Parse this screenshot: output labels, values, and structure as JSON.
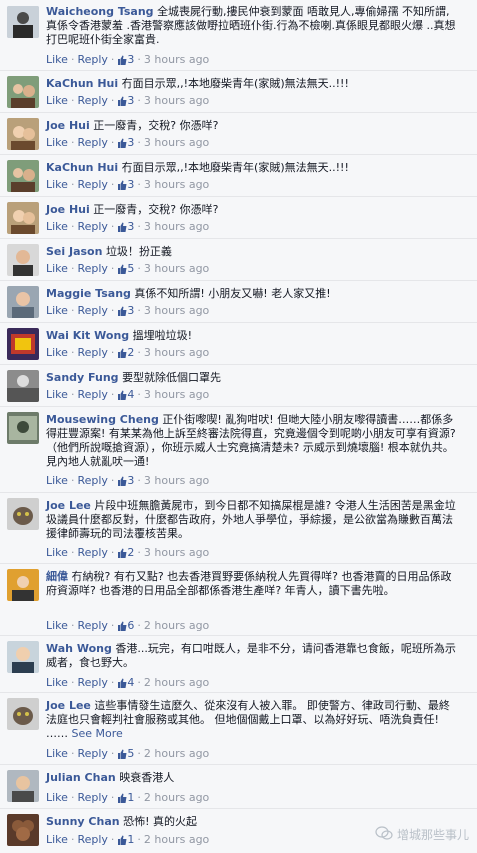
{
  "comments": [
    {
      "name": "Waicheong Tsang",
      "text": "全城喪屍行動,摟民仲衰到蒙面 唔敢見人,專偷婦孺 不知所謂,真係令香港蒙羞 .香港警察應該做嘢拉晒班仆街.行為不檢喇.真係眼見都眼火爆 ..真想打巴呢班仆街全家富貴.",
      "like": "Like",
      "reply": "Reply",
      "likes": "3",
      "time": "3 hours ago",
      "see_more": ""
    },
    {
      "name": "KaChun Hui",
      "text": "冇面目示眾,,!本地廢柴青年(家賊)無法無天..!!!",
      "like": "Like",
      "reply": "Reply",
      "likes": "3",
      "time": "3 hours ago",
      "see_more": ""
    },
    {
      "name": "Joe Hui",
      "text": "正一廢青，交稅? 你憑咩?",
      "like": "Like",
      "reply": "Reply",
      "likes": "3",
      "time": "3 hours ago",
      "see_more": ""
    },
    {
      "name": "KaChun Hui",
      "text": "冇面目示眾,,!本地廢柴青年(家賊)無法無天..!!!",
      "like": "Like",
      "reply": "Reply",
      "likes": "3",
      "time": "3 hours ago",
      "see_more": ""
    },
    {
      "name": "Joe Hui",
      "text": "正一廢青，交稅? 你憑咩?",
      "like": "Like",
      "reply": "Reply",
      "likes": "3",
      "time": "3 hours ago",
      "see_more": ""
    },
    {
      "name": "Sei Jason",
      "text": "垃圾！扮正義",
      "like": "Like",
      "reply": "Reply",
      "likes": "5",
      "time": "3 hours ago",
      "see_more": ""
    },
    {
      "name": "Maggie Tsang",
      "text": "真係不知所謂! 小朋友又嚇! 老人家又推!",
      "like": "Like",
      "reply": "Reply",
      "likes": "3",
      "time": "3 hours ago",
      "see_more": ""
    },
    {
      "name": "Wai Kit Wong",
      "text": "搵埋啦垃圾!",
      "like": "Like",
      "reply": "Reply",
      "likes": "2",
      "time": "3 hours ago",
      "see_more": ""
    },
    {
      "name": "Sandy Fung",
      "text": "要型就除低個口罩先",
      "like": "Like",
      "reply": "Reply",
      "likes": "4",
      "time": "3 hours ago",
      "see_more": ""
    },
    {
      "name": "Mousewing Cheng",
      "text": "正仆街嚟喫! 亂狗咁吠! 但哋大陸小朋友嚟得讀書……都係多得莊豐源案! 有某某為他上訴至終審法院得直，究竟邊個令到呢啲小朋友可享有資源? （他們所說嘅搶資源），你班示威人士究竟搞清楚未? 示威示到燒壞腦! 根本就仇共。見內地人就亂吠一通!",
      "like": "Like",
      "reply": "Reply",
      "likes": "3",
      "time": "3 hours ago",
      "see_more": ""
    },
    {
      "name": "Joe Lee",
      "text": "片段中班無膽黃屍市，到今日都不知搞屎棍是誰? 令港人生活困苦是黑金垃圾議員什麼都反對，什麼都告政府，外地人爭學位，爭綜援，是公欲當為賺數百萬法援律師壽玩的司法覆核苦果。",
      "like": "Like",
      "reply": "Reply",
      "likes": "2",
      "time": "3 hours ago",
      "see_more": ""
    },
    {
      "name": "細偉",
      "text": "冇納稅? 有冇又點? 也去香港買野要係納稅人先買得咩? 也香港賣的日用品係政府資源咩? 也香港的日用品全部都係香港生產咩? 年青人，讀下書先啦。",
      "like": "Like",
      "reply": "Reply",
      "likes": "6",
      "time": "2 hours ago",
      "see_more": ""
    },
    {
      "name": "Wah Wong",
      "text": "香港...玩完，有口咁既人，是非不分，请问香港靠乜食飯，呢班所為示威者，食乜野大。",
      "like": "Like",
      "reply": "Reply",
      "likes": "4",
      "time": "2 hours ago",
      "see_more": ""
    },
    {
      "name": "Joe Lee",
      "text": "這些事情發生這麼久、從來沒有人被入罪。 即使警方、律政司行動、最終法庭也只會輕判社會服務或其他。 但地個個戴上口罩、以為好好玩、唔洗負責任! ……",
      "like": "Like",
      "reply": "Reply",
      "likes": "5",
      "time": "2 hours ago",
      "see_more": "See More"
    },
    {
      "name": "Julian Chan",
      "text": "映衰香港人",
      "like": "Like",
      "reply": "Reply",
      "likes": "1",
      "time": "2 hours ago",
      "see_more": ""
    },
    {
      "name": "Sunny Chan",
      "text": "恐怖! 真的火起",
      "like": "Like",
      "reply": "Reply",
      "likes": "1",
      "time": "2 hours ago",
      "see_more": ""
    }
  ],
  "watermark": "增城那些事儿",
  "colors": {
    "link": "#3b5998",
    "meta": "#9197a3",
    "bg": "#f6f7f9"
  }
}
